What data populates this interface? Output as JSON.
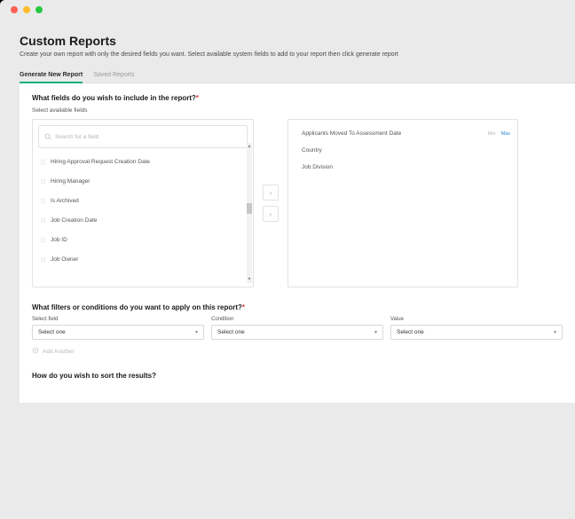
{
  "header": {
    "title": "Custom Reports",
    "description": "Create your own report with only the desired fields you want. Select available system fields to add to your report then click generate report"
  },
  "tabs": [
    {
      "label": "Generate New Report",
      "active": true
    },
    {
      "label": "Saved Reports",
      "active": false
    }
  ],
  "fields_section": {
    "title": "What fields do you wish to include in the report?",
    "sub_label": "Select available fields",
    "search_placeholder": "Search for a field",
    "available": [
      "Hiring Approval Request Creation Date",
      "Hiring Manager",
      "Is Archived",
      "Job Creation Date",
      "Job ID",
      "Job Owner"
    ],
    "selected": [
      {
        "label": "Applicants Moved To Assessment Date",
        "min": "Min",
        "max": "Max"
      },
      {
        "label": "Country"
      },
      {
        "label": "Job Division"
      }
    ]
  },
  "filters_section": {
    "title": "What filters or conditions do you want to apply on this report?",
    "columns": [
      {
        "label": "Select field",
        "value": "Select one"
      },
      {
        "label": "Condition",
        "value": "Select one"
      },
      {
        "label": "Value",
        "value": "Select one"
      }
    ],
    "add_another": "Add Another"
  },
  "sort_section": {
    "title": "How do you wish to sort the results?"
  }
}
